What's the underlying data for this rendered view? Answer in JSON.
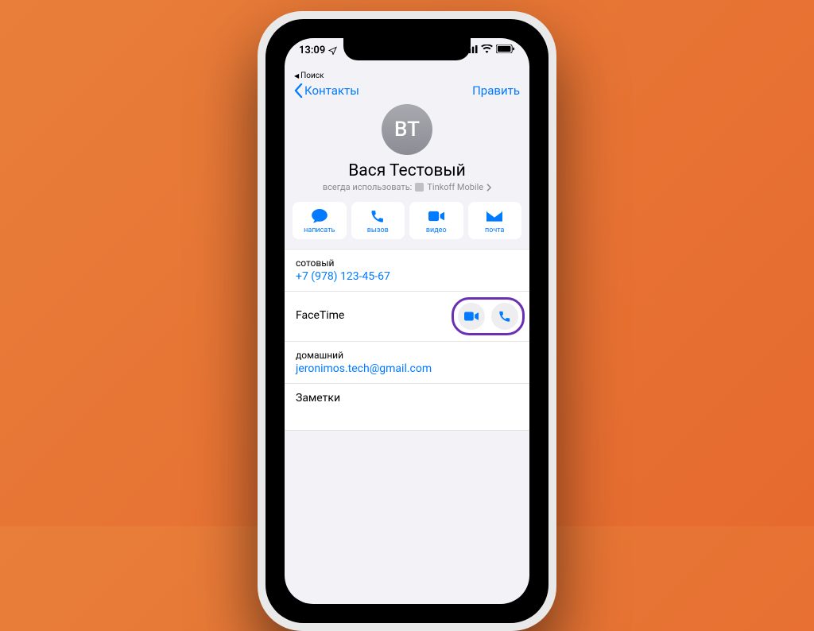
{
  "status": {
    "time": "13:09",
    "breadcrumb": "Поиск"
  },
  "nav": {
    "back": "Контакты",
    "edit": "Править"
  },
  "contact": {
    "initials": "ВТ",
    "name": "Вася Тестовый",
    "always_use_prefix": "всегда использовать:",
    "carrier": "Tinkoff Mobile"
  },
  "actions": {
    "message": "написать",
    "call": "вызов",
    "video": "видео",
    "mail": "почта"
  },
  "rows": {
    "phone_label": "сотовый",
    "phone_value": "+7 (978) 123-45-67",
    "facetime_label": "FaceTime",
    "email_label": "домашний",
    "email_value": "jeronimos.tech@gmail.com",
    "notes_label": "Заметки"
  }
}
